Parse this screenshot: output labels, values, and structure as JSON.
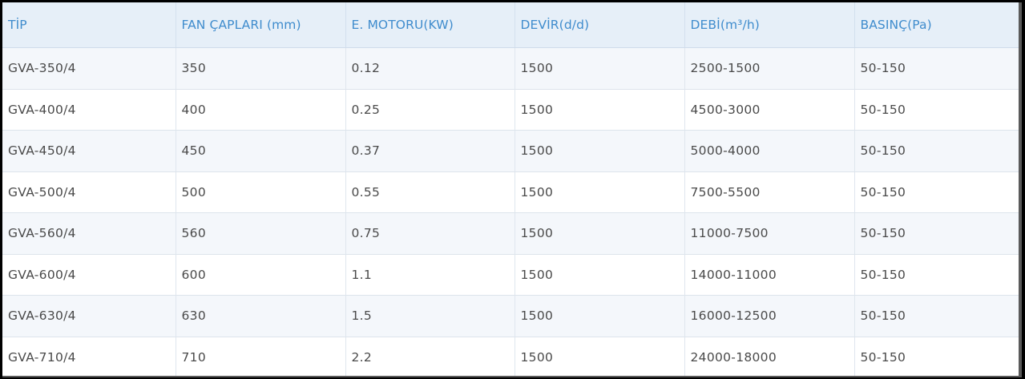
{
  "table": {
    "headers": [
      "TİP",
      "FAN ÇAPLARI (mm)",
      "E. MOTORU(KW)",
      "DEVİR(d/d)",
      "DEBİ(m³/h)",
      "BASINÇ(Pa)"
    ],
    "rows": [
      [
        "GVA-350/4",
        "350",
        "0.12",
        "1500",
        "2500-1500",
        "50-150"
      ],
      [
        "GVA-400/4",
        "400",
        "0.25",
        "1500",
        "4500-3000",
        "50-150"
      ],
      [
        "GVA-450/4",
        "450",
        "0.37",
        "1500",
        "5000-4000",
        "50-150"
      ],
      [
        "GVA-500/4",
        "500",
        "0.55",
        "1500",
        "7500-5500",
        "50-150"
      ],
      [
        "GVA-560/4",
        "560",
        "0.75",
        "1500",
        "11000-7500",
        "50-150"
      ],
      [
        "GVA-600/4",
        "600",
        "1.1",
        "1500",
        "14000-11000",
        "50-150"
      ],
      [
        "GVA-630/4",
        "630",
        "1.5",
        "1500",
        "16000-12500",
        "50-150"
      ],
      [
        "GVA-710/4",
        "710",
        "2.2",
        "1500",
        "24000-18000",
        "50-150"
      ]
    ]
  },
  "colors": {
    "header_text": "#3f8ccd",
    "header_bg": "#e6eff8",
    "row_alt_bg": "#f4f7fb",
    "cell_text": "#4a4a4a"
  }
}
